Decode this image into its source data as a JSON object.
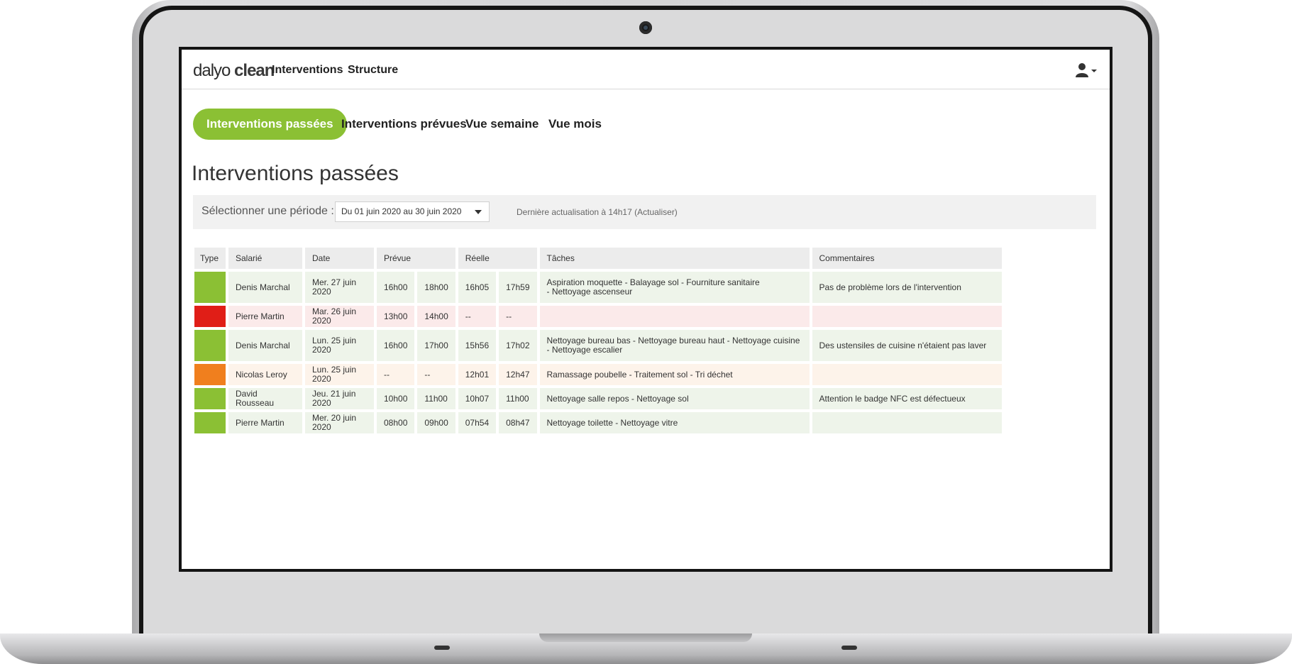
{
  "brand": {
    "name_part1": "dalyo",
    "name_part2": "clean"
  },
  "nav": {
    "interventions": "Interventions",
    "structure": "Structure"
  },
  "tabs": [
    {
      "label": "Interventions passées",
      "active": true
    },
    {
      "label": "Interventions prévues",
      "active": false
    },
    {
      "label": "Vue semaine",
      "active": false
    },
    {
      "label": "Vue mois",
      "active": false
    }
  ],
  "page_title": "Interventions passées",
  "filter": {
    "label": "Sélectionner une période :",
    "period_value": "Du 01 juin 2020 au 30 juin 2020",
    "refresh_prefix": "Dernière actualisation à 14h17",
    "refresh_link": "(Actualiser)"
  },
  "table": {
    "headers": {
      "type": "Type",
      "employee": "Salarié",
      "date": "Date",
      "planned": "Prévue",
      "actual": "Réelle",
      "tasks": "Tâches",
      "comments": "Commentaires"
    },
    "rows": [
      {
        "status": "ok",
        "employee": "Denis Marchal",
        "date": "Mer. 27 juin 2020",
        "planned_start": "16h00",
        "planned_end": "18h00",
        "actual_start": "16h05",
        "actual_end": "17h59",
        "tasks": "Aspiration moquette - Balayage sol - Fourniture sanitaire\n- Nettoyage ascenseur",
        "comment": "Pas de problème lors de l'intervention"
      },
      {
        "status": "cancel",
        "employee": "Pierre Martin",
        "date": "Mar. 26 juin 2020",
        "planned_start": "13h00",
        "planned_end": "14h00",
        "actual_start": "--",
        "actual_end": "--",
        "tasks": "",
        "comment": ""
      },
      {
        "status": "ok",
        "employee": "Denis Marchal",
        "date": "Lun. 25 juin 2020",
        "planned_start": "16h00",
        "planned_end": "17h00",
        "actual_start": "15h56",
        "actual_end": "17h02",
        "tasks": "Nettoyage bureau bas - Nettoyage bureau haut - Nettoyage cuisine\n- Nettoyage escalier",
        "comment": "Des ustensiles de cuisine n'étaient pas laver"
      },
      {
        "status": "warn",
        "employee": "Nicolas Leroy",
        "date": "Lun. 25 juin 2020",
        "planned_start": "--",
        "planned_end": "--",
        "actual_start": "12h01",
        "actual_end": "12h47",
        "tasks": "Ramassage poubelle - Traitement sol -  Tri déchet",
        "comment": ""
      },
      {
        "status": "ok",
        "employee": "David Rousseau",
        "date": "Jeu. 21 juin 2020",
        "planned_start": "10h00",
        "planned_end": "11h00",
        "actual_start": "10h07",
        "actual_end": "11h00",
        "tasks": "Nettoyage salle repos - Nettoyage sol",
        "comment": "Attention le badge NFC est défectueux"
      },
      {
        "status": "ok",
        "employee": "Pierre Martin",
        "date": "Mer. 20 juin 2020",
        "planned_start": "08h00",
        "planned_end": "09h00",
        "actual_start": "07h54",
        "actual_end": "08h47",
        "tasks": "Nettoyage toilette - Nettoyage vitre",
        "comment": ""
      }
    ]
  },
  "colors": {
    "accent": "#8bc034",
    "ok": "#8bc034",
    "cancel": "#e01e17",
    "warn": "#f07f1e"
  },
  "icons": {
    "user_menu": "user-icon",
    "dropdown": "chevron-down-icon"
  }
}
